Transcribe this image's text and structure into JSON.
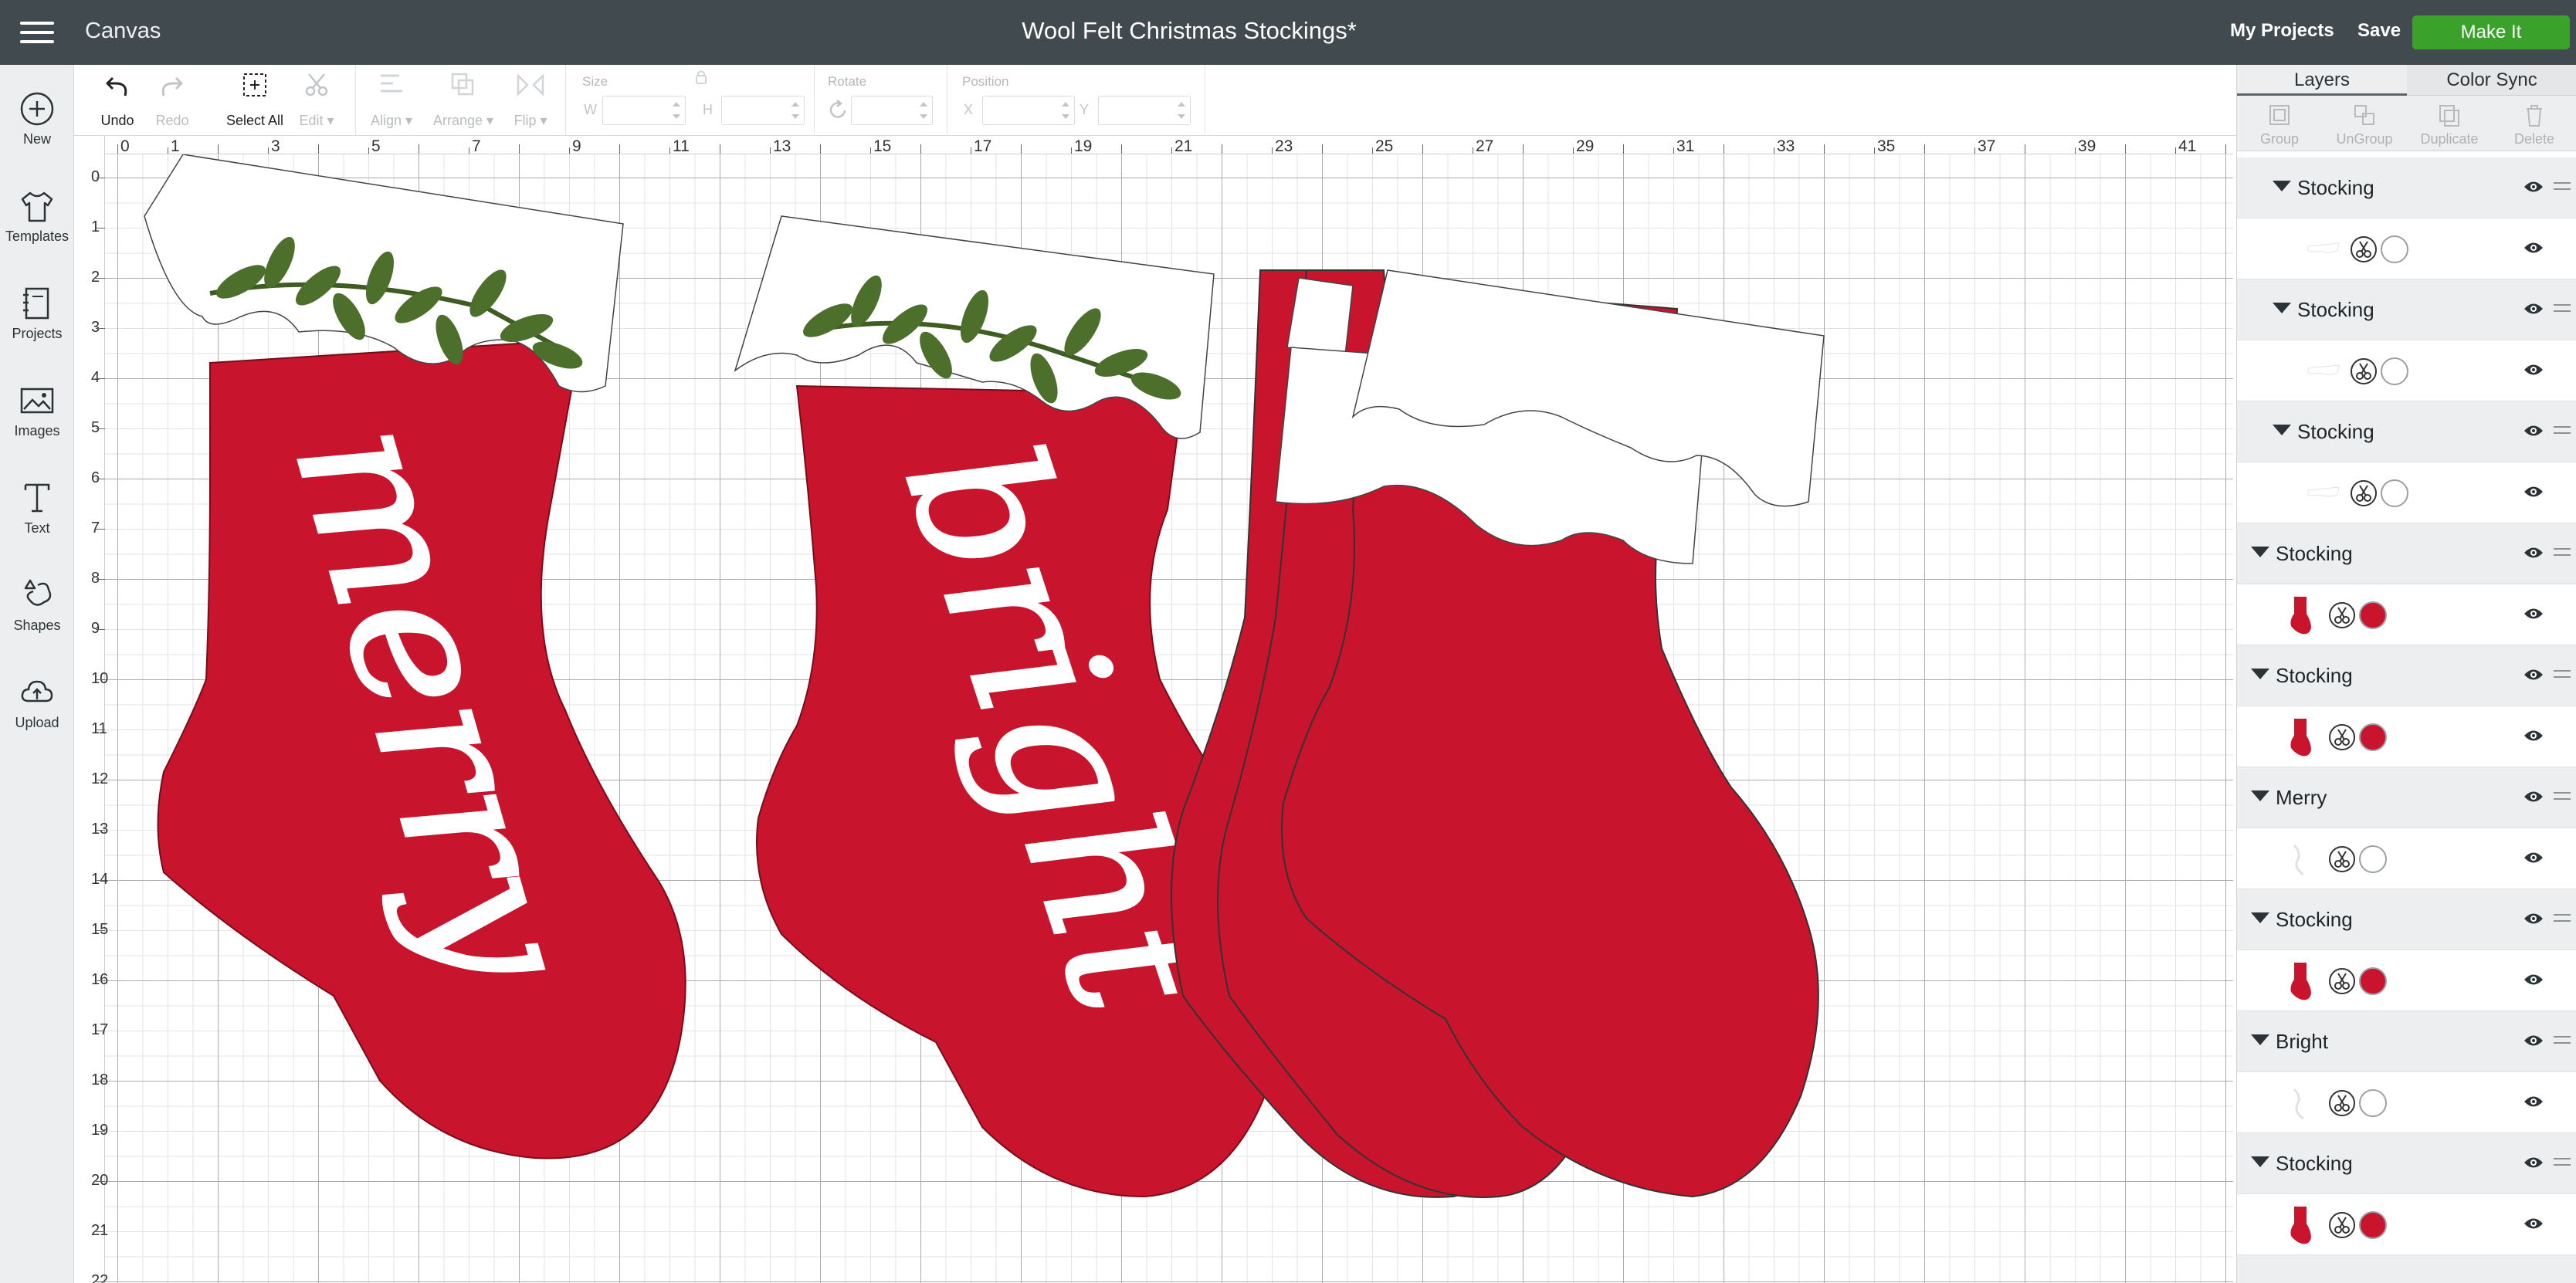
{
  "topbar": {
    "app_name": "Canvas",
    "doc_title": "Wool Felt Christmas Stockings*",
    "my_projects": "My Projects",
    "save": "Save",
    "make_it": "Make It"
  },
  "sidebar": {
    "items": [
      {
        "label": "New",
        "icon": "plus-circle-icon"
      },
      {
        "label": "Templates",
        "icon": "tshirt-icon"
      },
      {
        "label": "Projects",
        "icon": "notebook-icon"
      },
      {
        "label": "Images",
        "icon": "image-icon"
      },
      {
        "label": "Text",
        "icon": "text-icon"
      },
      {
        "label": "Shapes",
        "icon": "shapes-icon"
      },
      {
        "label": "Upload",
        "icon": "cloud-upload-icon"
      }
    ]
  },
  "toolbar": {
    "undo": "Undo",
    "redo": "Redo",
    "select_all": "Select All",
    "edit": "Edit",
    "align": "Align",
    "arrange": "Arrange",
    "flip": "Flip",
    "size_label": "Size",
    "w_prefix": "W",
    "h_prefix": "H",
    "rotate_label": "Rotate",
    "position_label": "Position",
    "x_prefix": "X",
    "y_prefix": "Y"
  },
  "rulers": {
    "top": [
      "0",
      "1",
      "3",
      "5",
      "7",
      "9",
      "11",
      "13",
      "15",
      "17",
      "19",
      "21",
      "23",
      "25",
      "27",
      "29",
      "31",
      "33",
      "35",
      "37",
      "39",
      "41"
    ],
    "left": [
      "0",
      "1",
      "2",
      "3",
      "4",
      "5",
      "6",
      "7",
      "8",
      "9",
      "10",
      "11",
      "12",
      "13",
      "14",
      "15",
      "16",
      "17",
      "18",
      "19",
      "20",
      "21",
      "22"
    ]
  },
  "canvas": {
    "words": [
      "merry",
      "bright"
    ],
    "colors": {
      "stocking_red": "#c8142c",
      "cuff_white": "#ffffff",
      "leaf_green": "#4c6f2c",
      "grid": "#e1e3e5"
    }
  },
  "right_panel": {
    "tabs": [
      "Layers",
      "Color Sync"
    ],
    "actions": [
      "Group",
      "UnGroup",
      "Duplicate",
      "Delete"
    ],
    "layers": [
      {
        "type": "group",
        "name": "Stocking",
        "indent": 1
      },
      {
        "type": "child",
        "swatch": "#ffffff",
        "thumb": "white",
        "indent": 1
      },
      {
        "type": "group",
        "name": "Stocking",
        "indent": 1
      },
      {
        "type": "child",
        "swatch": "#ffffff",
        "thumb": "white",
        "indent": 1
      },
      {
        "type": "group",
        "name": "Stocking",
        "indent": 1
      },
      {
        "type": "child",
        "swatch": "#ffffff",
        "thumb": "white",
        "indent": 1
      },
      {
        "type": "group",
        "name": "Stocking",
        "indent": 0
      },
      {
        "type": "child",
        "swatch": "#c8142c",
        "thumb": "red",
        "indent": 0
      },
      {
        "type": "group",
        "name": "Stocking",
        "indent": 0
      },
      {
        "type": "child",
        "swatch": "#c8142c",
        "thumb": "red",
        "indent": 0
      },
      {
        "type": "group",
        "name": "Merry",
        "indent": 0
      },
      {
        "type": "child",
        "swatch": "#ffffff",
        "thumb": "text",
        "indent": 0
      },
      {
        "type": "group",
        "name": "Stocking",
        "indent": 0
      },
      {
        "type": "child",
        "swatch": "#c8142c",
        "thumb": "red",
        "indent": 0
      },
      {
        "type": "group",
        "name": "Bright",
        "indent": 0
      },
      {
        "type": "child",
        "swatch": "#ffffff",
        "thumb": "text",
        "indent": 0
      },
      {
        "type": "group",
        "name": "Stocking",
        "indent": 0
      },
      {
        "type": "child",
        "swatch": "#c8142c",
        "thumb": "red",
        "indent": 0
      }
    ]
  }
}
